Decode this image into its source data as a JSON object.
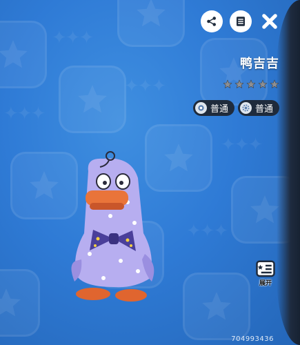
{
  "character": {
    "name": "鸭吉吉",
    "star_rating": 0,
    "star_max": 5,
    "tags": [
      {
        "icon": "flower-icon",
        "label": "普通"
      },
      {
        "icon": "gear-icon",
        "label": "普通"
      }
    ]
  },
  "toolbar": {
    "share_icon": "share-icon",
    "list_icon": "list-icon",
    "close_icon": "close-icon"
  },
  "side_button": {
    "label": "展开",
    "icon": "list-star-icon"
  },
  "uid": "704993436",
  "colors": {
    "background": "#2f7bd6",
    "badge_bg": "#1f2b3c",
    "side_panel": "#1e2b3f"
  }
}
